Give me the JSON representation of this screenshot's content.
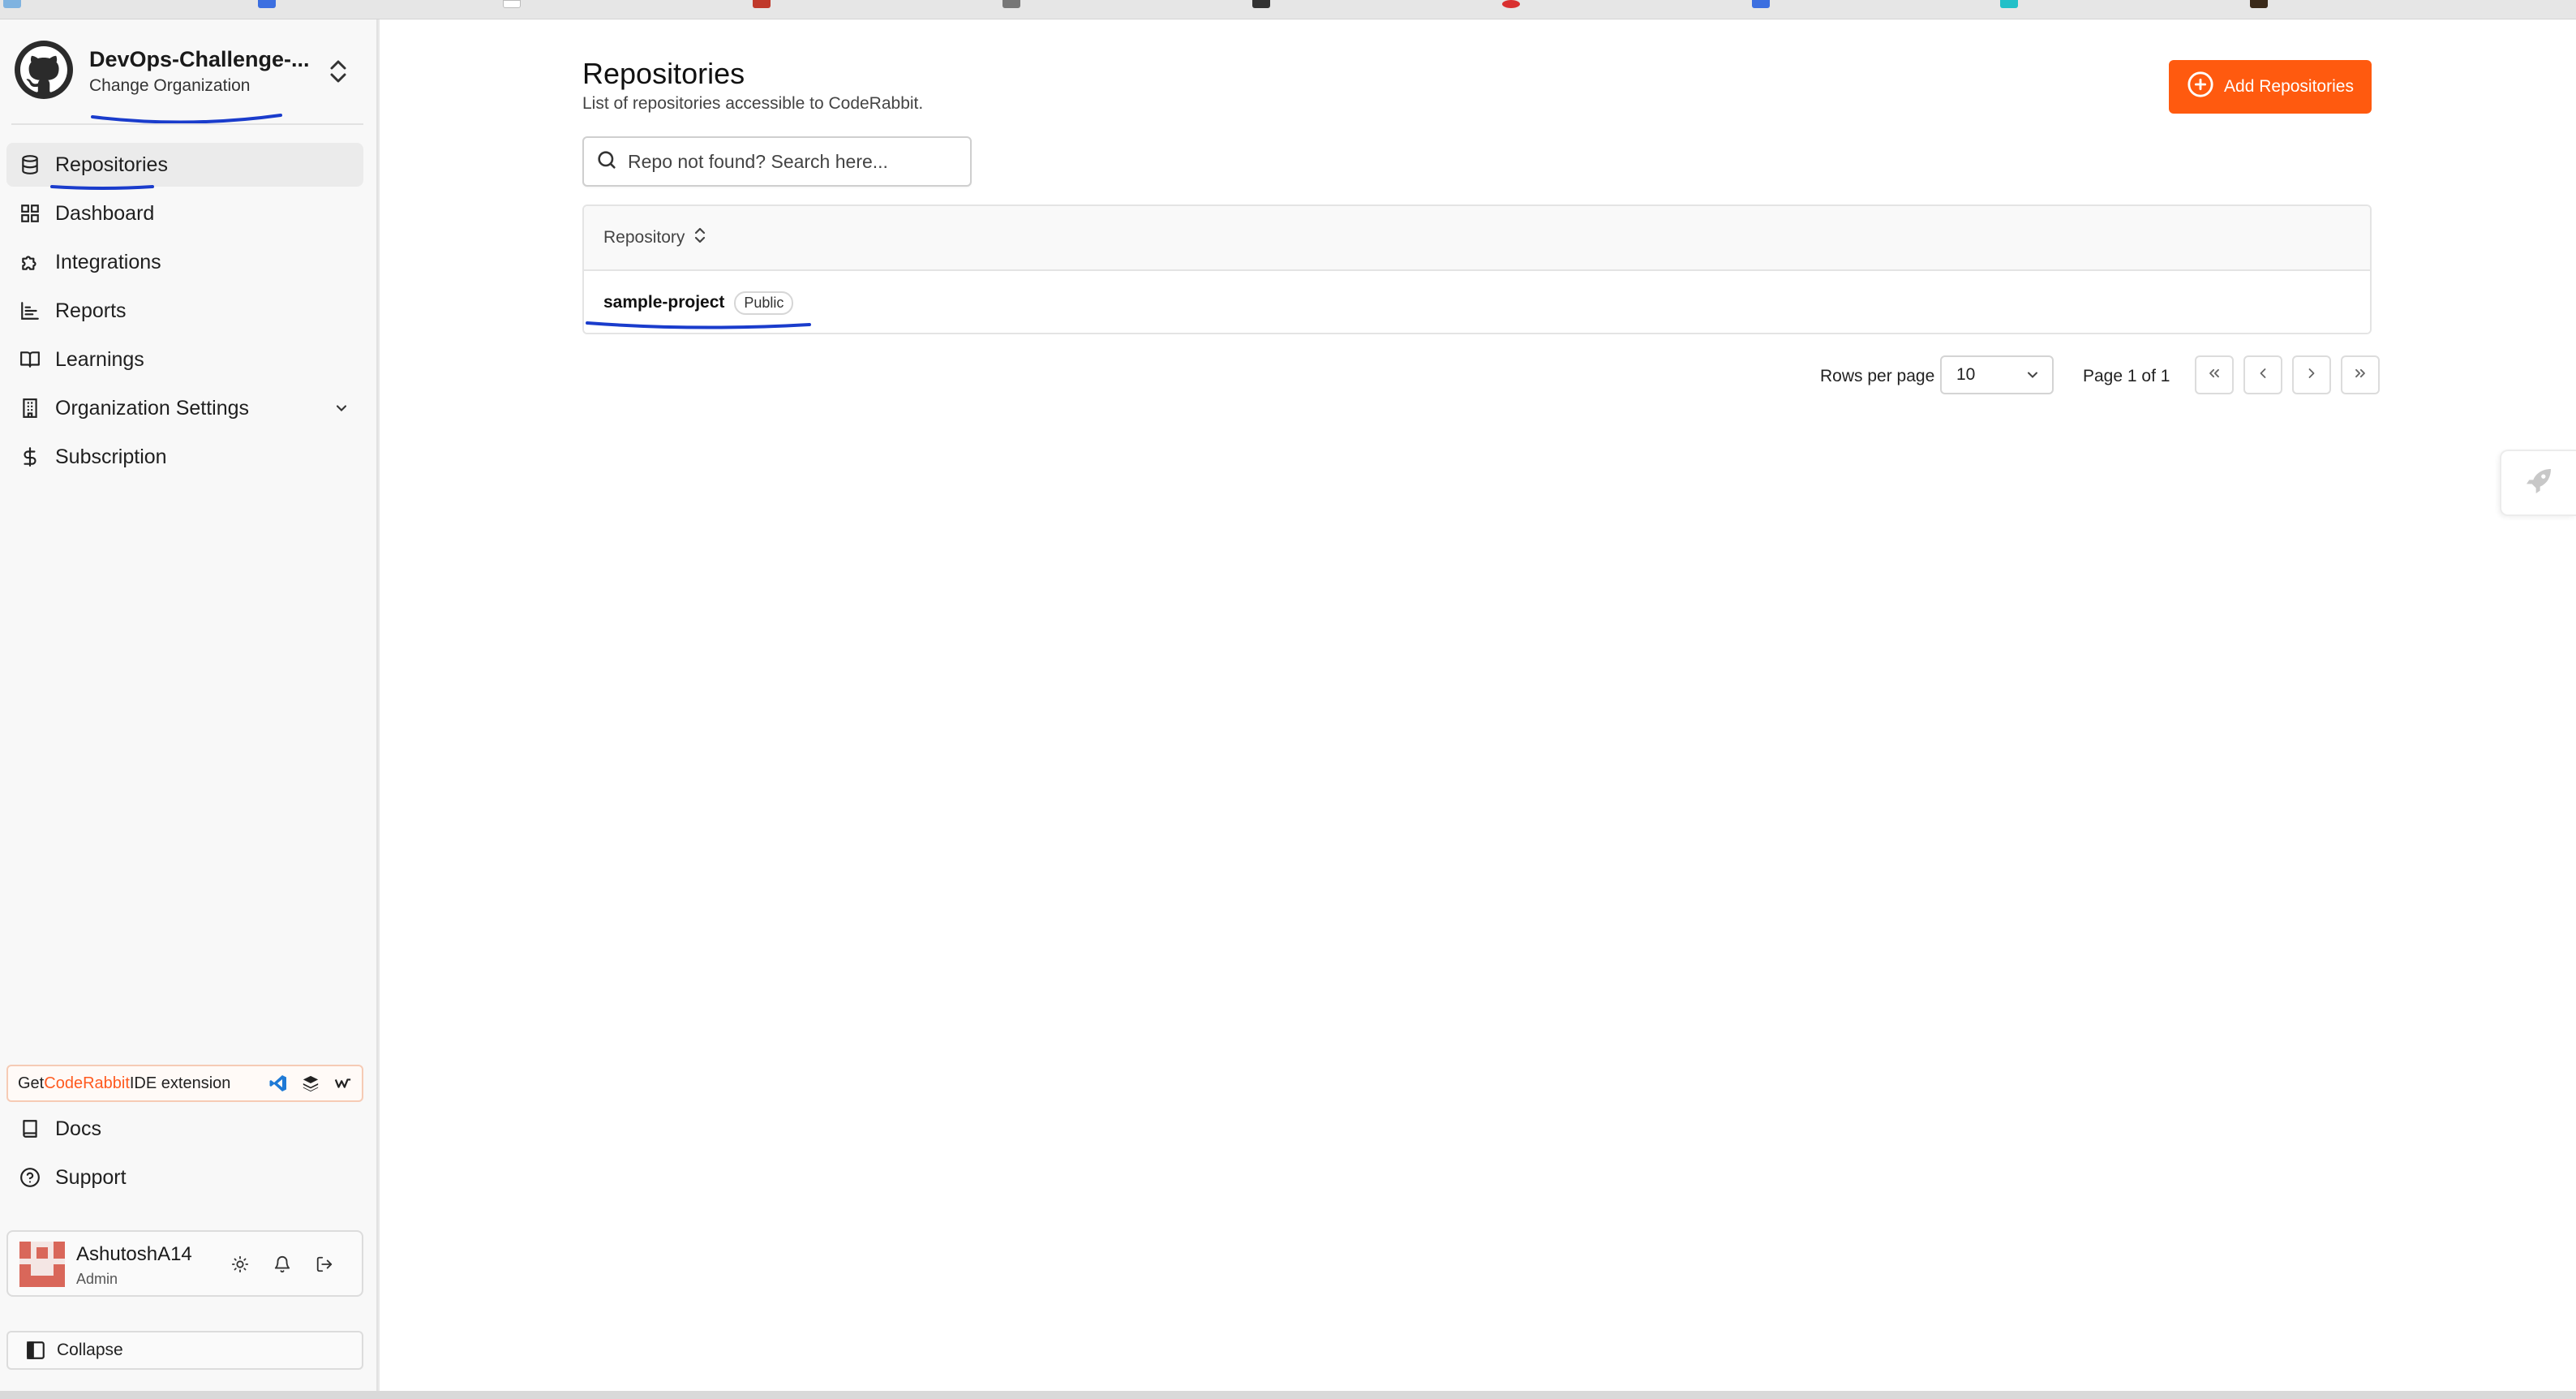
{
  "org": {
    "name": "DevOps-Challenge-...",
    "change_label": "Change Organization"
  },
  "sidebar": {
    "items": [
      {
        "label": "Repositories",
        "icon": "database-icon",
        "active": true
      },
      {
        "label": "Dashboard",
        "icon": "grid-icon"
      },
      {
        "label": "Integrations",
        "icon": "puzzle-icon"
      },
      {
        "label": "Reports",
        "icon": "bar-chart-icon"
      },
      {
        "label": "Learnings",
        "icon": "book-open-icon"
      },
      {
        "label": "Organization Settings",
        "icon": "building-icon",
        "expandable": true
      },
      {
        "label": "Subscription",
        "icon": "dollar-icon"
      }
    ],
    "ide_banner": {
      "prefix": "Get ",
      "brand": "CodeRabbit",
      "suffix": " IDE extension"
    },
    "bottom_items": [
      {
        "label": "Docs",
        "icon": "book-icon"
      },
      {
        "label": "Support",
        "icon": "help-circle-icon"
      }
    ],
    "user": {
      "name": "AshutoshA14",
      "role": "Admin"
    },
    "collapse_label": "Collapse"
  },
  "main": {
    "title": "Repositories",
    "subtitle": "List of repositories accessible to CodeRabbit.",
    "add_button": "Add Repositories",
    "search_placeholder": "Repo not found? Search here...",
    "table": {
      "header": "Repository",
      "rows": [
        {
          "name": "sample-project",
          "visibility": "Public"
        }
      ]
    },
    "pagination": {
      "rows_per_page_label": "Rows per page",
      "rows_per_page": "10",
      "page_info": "Page 1 of 1"
    }
  },
  "colors": {
    "accent": "#ff5a0f",
    "annotation": "#1a3ccc",
    "active_nav_bg": "#ebebeb"
  }
}
